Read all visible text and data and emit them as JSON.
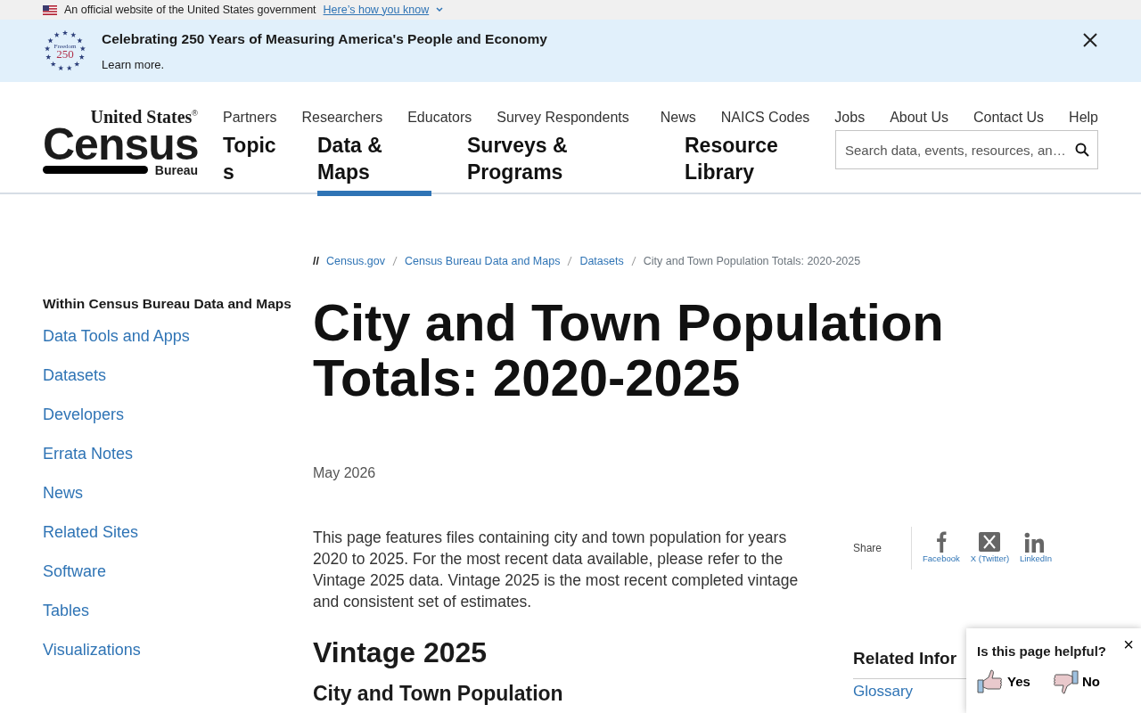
{
  "gov_banner": {
    "text": "An official website of the United States government",
    "link": "Here’s how you know"
  },
  "announcement": {
    "logo_top": "Freedom",
    "logo_number": "250",
    "title": "Celebrating 250 Years of Measuring America's People and Economy",
    "link": "Learn more."
  },
  "logo": {
    "line1": "United States",
    "mark": "®",
    "line2": "Census",
    "line3": "Bureau"
  },
  "utility_nav_left": [
    "Partners",
    "Researchers",
    "Educators",
    "Survey Respondents"
  ],
  "utility_nav_right": [
    "News",
    "NAICS Codes",
    "Jobs",
    "About Us",
    "Contact Us",
    "Help"
  ],
  "main_nav": [
    {
      "label": "Topics",
      "selected": false
    },
    {
      "label": "Data & Maps",
      "selected": true
    },
    {
      "label": "Surveys & Programs",
      "selected": false
    },
    {
      "label": "Resource Library",
      "selected": false
    }
  ],
  "search": {
    "placeholder": "Search data, events, resources, an…"
  },
  "sidebar": {
    "heading": "Within Census Bureau Data and Maps",
    "items": [
      "Data Tools and Apps",
      "Datasets",
      "Developers",
      "Errata Notes",
      "News",
      "Related Sites",
      "Software",
      "Tables",
      "Visualizations"
    ]
  },
  "breadcrumb": {
    "marker": "//",
    "links": [
      "Census.gov",
      "Census Bureau Data and Maps",
      "Datasets"
    ],
    "current": "City and Town Population Totals: 2020-2025"
  },
  "title": "City and Town Population Totals: 2020-2025",
  "date": "May 2026",
  "intro": "This page features files containing city and town population for years 2020 to 2025. For the most recent data available, please refer to the Vintage 2025 data.  Vintage 2025 is the most recent completed vintage and consistent set of estimates.",
  "section_heading": "Vintage 2025",
  "subsection_heading": "City and Town Population",
  "share": {
    "label": "Share",
    "items": [
      {
        "kind": "facebook",
        "label": "Facebook"
      },
      {
        "kind": "x",
        "label": "X (Twitter)"
      },
      {
        "kind": "linkedin",
        "label": "LinkedIn"
      }
    ]
  },
  "related": {
    "heading": "Related Infor",
    "links": [
      "Glossary"
    ]
  },
  "feedback": {
    "question": "Is this page helpful?",
    "close": "×",
    "options": [
      {
        "kind": "yes",
        "label": "Yes"
      },
      {
        "kind": "no",
        "label": "No"
      }
    ]
  }
}
